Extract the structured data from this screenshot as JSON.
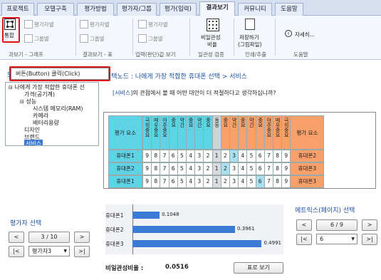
{
  "tabs": [
    "프로젝트",
    "모델구축",
    "평가방법",
    "평가자/그룹",
    "평가(입력)",
    "결과보기",
    "커뮤니티",
    "도움말"
  ],
  "active_tab": "결과보기",
  "ribbon": {
    "btn_tonghap": "통합",
    "btn_peongajabyeol": "평가자별",
    "btn_group": "그룹별",
    "btn_peongajabyeol2": "평가자별",
    "btn_group2": "그룹별",
    "btn_peongajabyeol3": "평가자별",
    "btn_group3": "그룹별",
    "btn_inconsistency": "비일관성",
    "btn_inconsistency2": "비율",
    "btn_save": "저장하기",
    "btn_save2": "(그림파일)",
    "btn_detail": "자세히...",
    "grp1": "과보기 - 그래프",
    "grp2": "결과보기 - 표",
    "grp3": "입력(판단)값 보기",
    "grp4": "일관성 검증",
    "grp5": "인쇄/추출",
    "grp6": "도움말"
  },
  "tooltip": "버튼(Button) 클릭(Click)",
  "left_title": "모델",
  "tree": {
    "root": "나에게 가장 적합한 휴대폰 선",
    "n1": "가격(공기계)",
    "n2": "성능",
    "n3": "시스템 메모리(RAM)",
    "n4": "카메라",
    "n5": "배터리용량",
    "n6": "디자인",
    "n7": "브랜드",
    "n8": "서비스"
  },
  "node_title": "선택노드 : 나에게 가장 적합한 휴대폰 선택 > 서비스",
  "question_bracket": "[서비스]",
  "question_rest": "의 관점에서 볼 때 어떤 대안이 더 적절하다고 생각하십니까?",
  "matrix": {
    "left_header": "평가 요소",
    "right_header": "평가 요소",
    "left_scale": [
      "극히중요",
      "매우중요",
      "아주중요",
      "중요",
      "약간",
      "중요",
      "약간",
      "중요"
    ],
    "mid_label": "동등",
    "right_scale": [
      "중요",
      "약간",
      "중요",
      "약간",
      "중요",
      "아주중요",
      "매우중요",
      "극히중요"
    ],
    "rows": [
      {
        "left": "휴대폰1",
        "vals": [
          "9",
          "8",
          "7",
          "6",
          "5",
          "4",
          "3",
          "2",
          "1",
          "2",
          "3",
          "4",
          "5",
          "6",
          "7",
          "8",
          "9"
        ],
        "right": "휴대폰2"
      },
      {
        "left": "휴대폰2",
        "vals": [
          "9",
          "8",
          "7",
          "6",
          "5",
          "4",
          "3",
          "2",
          "1",
          "2",
          "3",
          "4",
          "5",
          "6",
          "7",
          "8",
          "9"
        ],
        "right": "휴대폰3"
      },
      {
        "left": "휴대폰1",
        "vals": [
          "9",
          "8",
          "7",
          "6",
          "5",
          "4",
          "3",
          "2",
          "1",
          "2",
          "3",
          "4",
          "5",
          "6",
          "7",
          "8",
          "9"
        ],
        "right": "휴대폰3"
      }
    ]
  },
  "evaluator_title": "평가자 선택",
  "evaluator_page": "3 / 10",
  "evaluator_select": "평가자3",
  "metrics_title": "메트릭스(페이지) 선택",
  "metrics_page": "6 / 9",
  "metrics_select": "6",
  "chart_data": {
    "type": "bar",
    "categories": [
      "휴대폰1",
      "휴대폰2",
      "휴대폰3"
    ],
    "values": [
      0.1048,
      0.3961,
      0.4991
    ],
    "value_labels": [
      "0.1048",
      "0.3961",
      "0.4991"
    ],
    "xlim": [
      0,
      0.55
    ]
  },
  "inconsistency_label": "비일관성비율 :",
  "inconsistency_value": "0.0516",
  "table_button": "표로 보기",
  "nav": {
    "first": "|<",
    "prev": "<",
    "next": ">",
    "last": ">|"
  }
}
